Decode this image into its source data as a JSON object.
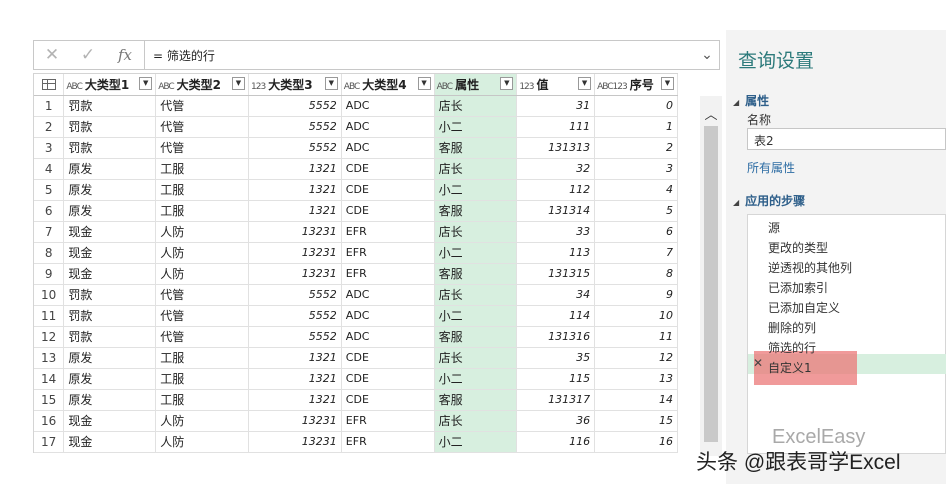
{
  "formula_bar": {
    "cancel_icon": "close-icon",
    "confirm_icon": "check-icon",
    "fx_label": "fx",
    "formula": "= 筛选的行"
  },
  "table": {
    "columns": [
      {
        "type_icon": "ABC",
        "name": "大类型1"
      },
      {
        "type_icon": "ABC",
        "name": "大类型2"
      },
      {
        "type_icon": "123",
        "name": "大类型3"
      },
      {
        "type_icon": "ABC",
        "name": "大类型4"
      },
      {
        "type_icon": "ABC",
        "name": "属性"
      },
      {
        "type_icon": "123",
        "name": "值"
      },
      {
        "type_icon": "ABC123",
        "name": "序号"
      }
    ],
    "rows": [
      {
        "n": "1",
        "c1": "罚款",
        "c2": "代管",
        "c3": "5552",
        "c4": "ADC",
        "c5": "店长",
        "c6": "31",
        "c7": "0"
      },
      {
        "n": "2",
        "c1": "罚款",
        "c2": "代管",
        "c3": "5552",
        "c4": "ADC",
        "c5": "小二",
        "c6": "111",
        "c7": "1"
      },
      {
        "n": "3",
        "c1": "罚款",
        "c2": "代管",
        "c3": "5552",
        "c4": "ADC",
        "c5": "客服",
        "c6": "131313",
        "c7": "2"
      },
      {
        "n": "4",
        "c1": "原发",
        "c2": "工服",
        "c3": "1321",
        "c4": "CDE",
        "c5": "店长",
        "c6": "32",
        "c7": "3"
      },
      {
        "n": "5",
        "c1": "原发",
        "c2": "工服",
        "c3": "1321",
        "c4": "CDE",
        "c5": "小二",
        "c6": "112",
        "c7": "4"
      },
      {
        "n": "6",
        "c1": "原发",
        "c2": "工服",
        "c3": "1321",
        "c4": "CDE",
        "c5": "客服",
        "c6": "131314",
        "c7": "5"
      },
      {
        "n": "7",
        "c1": "现金",
        "c2": "人防",
        "c3": "13231",
        "c4": "EFR",
        "c5": "店长",
        "c6": "33",
        "c7": "6"
      },
      {
        "n": "8",
        "c1": "现金",
        "c2": "人防",
        "c3": "13231",
        "c4": "EFR",
        "c5": "小二",
        "c6": "113",
        "c7": "7"
      },
      {
        "n": "9",
        "c1": "现金",
        "c2": "人防",
        "c3": "13231",
        "c4": "EFR",
        "c5": "客服",
        "c6": "131315",
        "c7": "8"
      },
      {
        "n": "10",
        "c1": "罚款",
        "c2": "代管",
        "c3": "5552",
        "c4": "ADC",
        "c5": "店长",
        "c6": "34",
        "c7": "9"
      },
      {
        "n": "11",
        "c1": "罚款",
        "c2": "代管",
        "c3": "5552",
        "c4": "ADC",
        "c5": "小二",
        "c6": "114",
        "c7": "10"
      },
      {
        "n": "12",
        "c1": "罚款",
        "c2": "代管",
        "c3": "5552",
        "c4": "ADC",
        "c5": "客服",
        "c6": "131316",
        "c7": "11"
      },
      {
        "n": "13",
        "c1": "原发",
        "c2": "工服",
        "c3": "1321",
        "c4": "CDE",
        "c5": "店长",
        "c6": "35",
        "c7": "12"
      },
      {
        "n": "14",
        "c1": "原发",
        "c2": "工服",
        "c3": "1321",
        "c4": "CDE",
        "c5": "小二",
        "c6": "115",
        "c7": "13"
      },
      {
        "n": "15",
        "c1": "原发",
        "c2": "工服",
        "c3": "1321",
        "c4": "CDE",
        "c5": "客服",
        "c6": "131317",
        "c7": "14"
      },
      {
        "n": "16",
        "c1": "现金",
        "c2": "人防",
        "c3": "13231",
        "c4": "EFR",
        "c5": "店长",
        "c6": "36",
        "c7": "15"
      },
      {
        "n": "17",
        "c1": "现金",
        "c2": "人防",
        "c3": "13231",
        "c4": "EFR",
        "c5": "小二",
        "c6": "116",
        "c7": "16"
      }
    ]
  },
  "query_settings": {
    "title": "查询设置",
    "properties_section": "属性",
    "name_label": "名称",
    "name_value": "表2",
    "all_properties_link": "所有属性",
    "applied_steps_section": "应用的步骤",
    "steps": [
      "源",
      "更改的类型",
      "逆透视的其他列",
      "已添加索引",
      "已添加自定义",
      "删除的列",
      "筛选的行",
      "自定义1"
    ],
    "selected_step_index": 7
  },
  "watermark": {
    "line1": "ExcelEasy",
    "line2": "头条 @跟表哥学Excel"
  },
  "colors": {
    "highlight_column": "#d7efdf",
    "pane_title": "#2c7a7b",
    "section_header": "#2e5f8a",
    "red_marker": "#eb7878"
  }
}
